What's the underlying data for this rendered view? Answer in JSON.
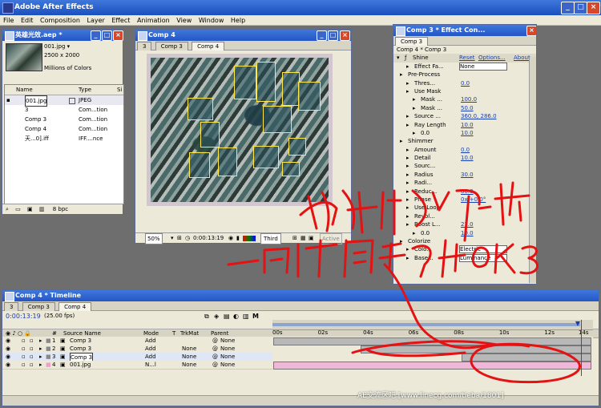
{
  "app": {
    "title": "Adobe After Effects"
  },
  "menu": [
    "File",
    "Edit",
    "Composition",
    "Layer",
    "Effect",
    "Animation",
    "View",
    "Window",
    "Help"
  ],
  "project": {
    "title": "英雄光效.aep *",
    "item_name": "001.jpg ▾",
    "item_dims": "2500 x 2000",
    "item_colors": "Millions of Colors",
    "col_name": "Name",
    "col_type": "Type",
    "col_size": "Si",
    "rows": [
      {
        "name": "001.jpg",
        "type": "JPEG",
        "color": "#e8a0c8"
      },
      {
        "name": "3",
        "type": "Com...tion",
        "color": "#c0c0c0"
      },
      {
        "name": "Comp 3",
        "type": "Com...tion",
        "color": "#c0c0c0"
      },
      {
        "name": "Comp 4",
        "type": "Com...tion",
        "color": "#c0c0c0"
      },
      {
        "name": "天...0].iff",
        "type": "IFF....nce",
        "color": "#e8e0a0"
      }
    ],
    "bpc": "8 bpc"
  },
  "comp_viewer": {
    "title": "Comp 4",
    "tabs": [
      "3",
      "Comp 3",
      "Comp 4"
    ],
    "zoom": "50%",
    "timecode": "0:00:13:19",
    "resolution": "Third",
    "camera": "Active"
  },
  "effect_controls": {
    "title": "Comp 3 * Effect Con...",
    "tab": "Comp 3",
    "breadcrumb": "Comp 4 * Comp 3",
    "effect_name": "Shine",
    "reset": "Reset",
    "options": "Options...",
    "about": "About...",
    "rows": [
      {
        "label": "Effect Fa...",
        "value": "None"
      },
      {
        "label": "Pre-Process",
        "value": ""
      },
      {
        "label": "Thres...",
        "value": "0.0"
      },
      {
        "label": "Use Mask",
        "value": ""
      },
      {
        "label": "Mask ...",
        "value": "100.0"
      },
      {
        "label": "Mask ...",
        "value": "50.0"
      },
      {
        "label": "Source ...",
        "value": "360.0, 286.0"
      },
      {
        "label": "Ray Length",
        "value": "10.0"
      },
      {
        "label": "0.0",
        "value": "10.0"
      },
      {
        "label": "Shimmer",
        "value": ""
      },
      {
        "label": "Amount",
        "value": "0.0"
      },
      {
        "label": "Detail",
        "value": "10.0"
      },
      {
        "label": "Sourc...",
        "value": ""
      },
      {
        "label": "Radius",
        "value": "30.0"
      },
      {
        "label": "Radi...",
        "value": ""
      },
      {
        "label": "Reduc...",
        "value": "80.0"
      },
      {
        "label": "Phase",
        "value": "0x +0.0°"
      },
      {
        "label": "Use Loop",
        "value": ""
      },
      {
        "label": "Revol...",
        "value": ""
      },
      {
        "label": "Boost L...",
        "value": "27.0"
      },
      {
        "label": "0.0",
        "value": "10.0"
      },
      {
        "label": "Colorize",
        "value": ""
      },
      {
        "label": "Colo...",
        "value": "Electric"
      },
      {
        "label": "Base...",
        "value": "Luminance"
      }
    ]
  },
  "timeline": {
    "title": "Comp 4 * Timeline",
    "tabs": [
      "3",
      "Comp 3",
      "Comp 4"
    ],
    "timecode": "0:00:13:19",
    "fps": "(25.00 fps)",
    "col_num": "#",
    "col_source": "Source Name",
    "col_mode": "Mode",
    "col_t": "T",
    "col_trkmat": "TrkMat",
    "col_parent": "Parent",
    "ruler": [
      "00s",
      "02s",
      "04s",
      "06s",
      "08s",
      "10s",
      "12s",
      "14s"
    ],
    "layers": [
      {
        "num": "1",
        "name": "Comp 3",
        "mode": "Add",
        "trkmat": "",
        "parent": "None"
      },
      {
        "num": "2",
        "name": "Comp 3",
        "mode": "Add",
        "trkmat": "None",
        "parent": "None"
      },
      {
        "num": "3",
        "name": "Comp 3",
        "mode": "Add",
        "trkmat": "None",
        "parent": "None"
      },
      {
        "num": "4",
        "name": "001.jpg",
        "mode": "N...l",
        "trkmat": "None",
        "parent": "None"
      }
    ]
  },
  "annotation": {
    "line1": "复制几层 调节",
    "line2": "一下时间条 后面OK3"
  },
  "watermark": "AE交流区吧 [www.linecg.com/tieba/1801]",
  "colors": {
    "title_blue": "#2456c6",
    "ink_red": "#e41212",
    "panel_bg": "#ece9d8"
  }
}
